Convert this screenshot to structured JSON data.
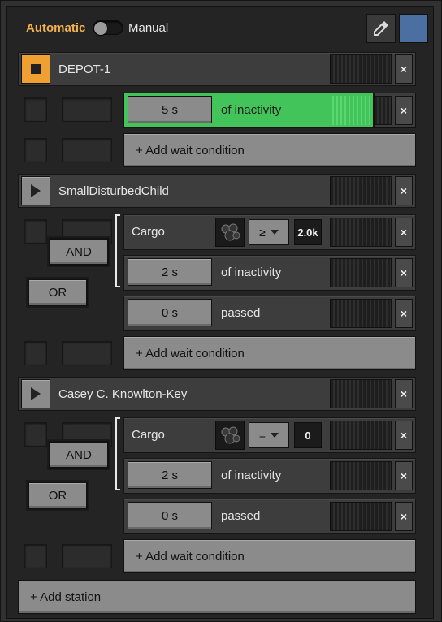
{
  "topbar": {
    "automatic_label": "Automatic",
    "manual_label": "Manual",
    "eyedropper_icon": "eyedropper-icon",
    "color_swatch": "#4a6fa0"
  },
  "stations": [
    {
      "name": "DEPOT-1",
      "state_icon": "stop-icon",
      "conditions": [
        {
          "value": "5 s",
          "text": "of inactivity",
          "progress": 1.0,
          "active_color": "#42c45a"
        }
      ],
      "add_wait_label": "+ Add wait condition"
    },
    {
      "name": "SmallDisturbedChild",
      "state_icon": "play-icon",
      "logic": [
        "AND",
        "OR"
      ],
      "conditions": [
        {
          "type": "cargo",
          "label": "Cargo",
          "comparator": "≥",
          "value": "2.0k"
        },
        {
          "value": "2 s",
          "text": "of inactivity"
        },
        {
          "value": "0 s",
          "text": "passed"
        }
      ],
      "add_wait_label": "+ Add wait condition"
    },
    {
      "name": "Casey C. Knowlton-Key",
      "state_icon": "play-icon",
      "logic": [
        "AND",
        "OR"
      ],
      "conditions": [
        {
          "type": "cargo",
          "label": "Cargo",
          "comparator": "=",
          "value": "0"
        },
        {
          "value": "2 s",
          "text": "of inactivity"
        },
        {
          "value": "0 s",
          "text": "passed"
        }
      ],
      "add_wait_label": "+ Add wait condition"
    }
  ],
  "add_station_label": "+ Add station",
  "close_symbol": "×",
  "colors": {
    "accent_orange": "#f2b24d",
    "active_green": "#42c45a"
  }
}
